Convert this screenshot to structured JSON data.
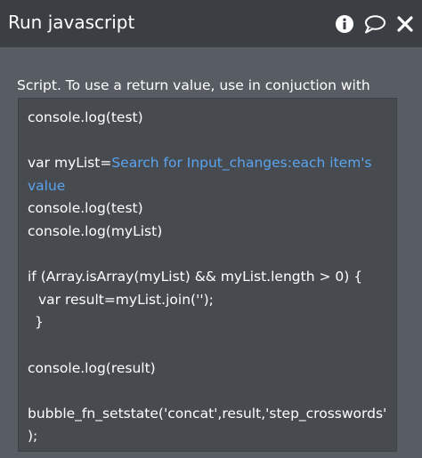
{
  "window": {
    "title": "Run javascript"
  },
  "field": {
    "label": "Script. To use a return value, use in conjuction with"
  },
  "code": {
    "line1": "console.log(test)",
    "line3_prefix": "var myList=",
    "line3_dynamic": "Search for Input_changes:each item's",
    "line4_dynamic": "value",
    "line5": "console.log(test)",
    "line6": "console.log(myList)",
    "line8": "if (Array.isArray(myList) && myList.length > 0) {",
    "line9": "var result=myList.join('');",
    "line10": "}",
    "line12": "console.log(result)",
    "line14": "bubble_fn_setstate('concat',result,'step_crosswords'",
    "line15": ");"
  },
  "colors": {
    "header_bg": "#3b3f43",
    "panel_bg": "#575d63",
    "editor_bg": "#474b4f",
    "dynamic_text": "#5aa3ee"
  },
  "icons": [
    "info-icon",
    "comment-icon",
    "close-icon"
  ]
}
